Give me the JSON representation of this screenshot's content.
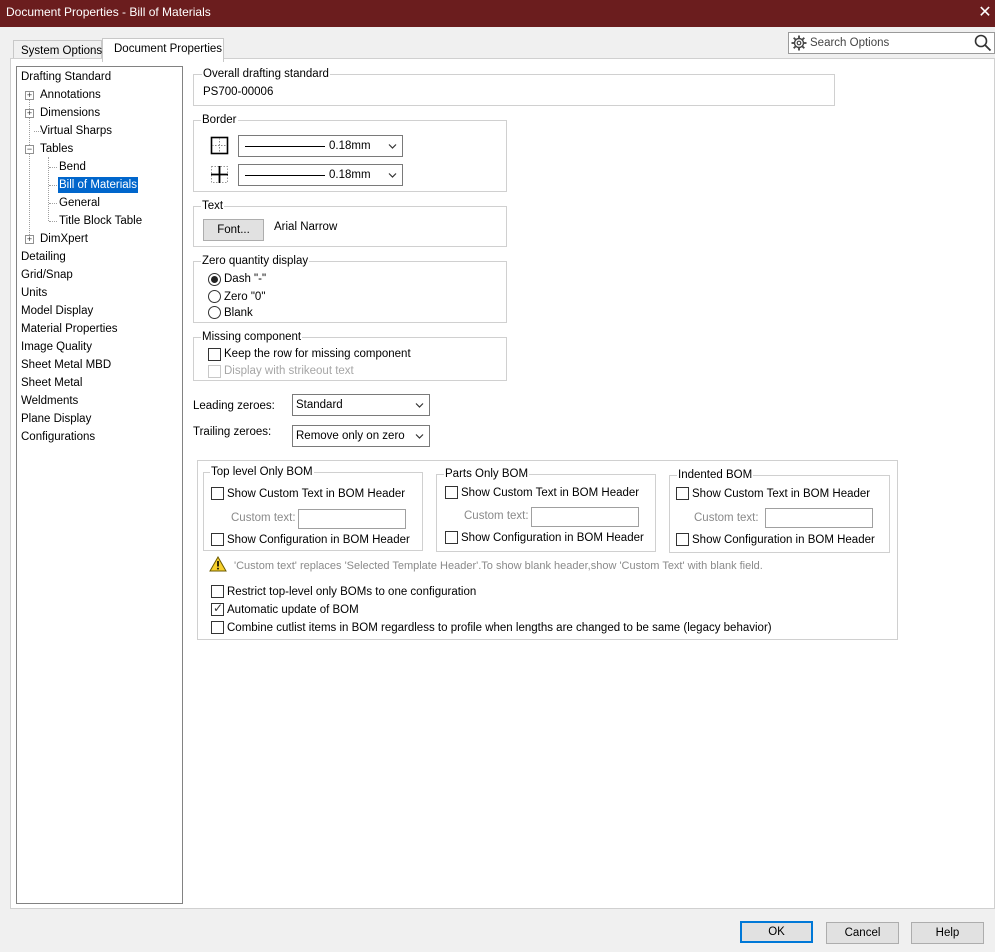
{
  "window": {
    "title": "Document Properties - Bill of Materials"
  },
  "tabs": [
    {
      "label": "System Options"
    },
    {
      "label": "Document Properties"
    }
  ],
  "search": {
    "placeholder": "Search Options"
  },
  "tree": {
    "items": [
      {
        "label": "Drafting Standard"
      },
      {
        "label": "Annotations"
      },
      {
        "label": "Dimensions"
      },
      {
        "label": "Virtual Sharps"
      },
      {
        "label": "Tables"
      },
      {
        "label": "Bend"
      },
      {
        "label": "Bill of Materials"
      },
      {
        "label": "General"
      },
      {
        "label": "Title Block Table"
      },
      {
        "label": "DimXpert"
      },
      {
        "label": "Detailing"
      },
      {
        "label": "Grid/Snap"
      },
      {
        "label": "Units"
      },
      {
        "label": "Model Display"
      },
      {
        "label": "Material Properties"
      },
      {
        "label": "Image Quality"
      },
      {
        "label": "Sheet Metal MBD"
      },
      {
        "label": "Sheet Metal"
      },
      {
        "label": "Weldments"
      },
      {
        "label": "Plane Display"
      },
      {
        "label": "Configurations"
      }
    ]
  },
  "overall": {
    "label": "Overall drafting standard",
    "value": "PS700-00006"
  },
  "border": {
    "label": "Border",
    "line1": "0.18mm",
    "line2": "0.18mm"
  },
  "text": {
    "label": "Text",
    "font_button": "Font...",
    "font_name": "Arial Narrow"
  },
  "zero_qty": {
    "label": "Zero quantity display",
    "options": [
      "Dash \"-\"",
      "Zero \"0\"",
      "Blank"
    ],
    "selected_index": 0
  },
  "missing": {
    "label": "Missing component",
    "keep_row": "Keep the row for missing component",
    "strikeout": "Display with strikeout text"
  },
  "leading": {
    "label": "Leading zeroes:",
    "value": "Standard"
  },
  "trailing": {
    "label": "Trailing zeroes:",
    "value": "Remove only on zero"
  },
  "bom": {
    "top_level": {
      "label": "Top level Only BOM",
      "show_custom": "Show Custom Text in BOM Header",
      "custom_text_label": "Custom text:",
      "show_config": "Show Configuration in BOM Header"
    },
    "parts_only": {
      "label": "Parts Only BOM",
      "show_custom": "Show Custom Text in BOM Header",
      "custom_text_label": "Custom text:",
      "show_config": "Show Configuration in BOM Header"
    },
    "indented": {
      "label": "Indented BOM",
      "show_custom": "Show Custom Text in BOM Header",
      "custom_text_label": "Custom text:",
      "show_config": "Show Configuration in BOM Header"
    },
    "note": "'Custom text' replaces 'Selected Template Header'.To show blank header,show 'Custom Text' with blank field.",
    "restrict": "Restrict top-level only BOMs to one configuration",
    "auto_update": "Automatic update of BOM",
    "auto_update_checked": true,
    "combine": "Combine cutlist items in BOM regardless to profile when lengths are changed to be same (legacy behavior)"
  },
  "buttons": {
    "ok": "OK",
    "cancel": "Cancel",
    "help": "Help"
  },
  "colors": {
    "titlebar": "#6b1d1e",
    "selection": "#0066cc",
    "default_button_border": "#0078d7"
  }
}
